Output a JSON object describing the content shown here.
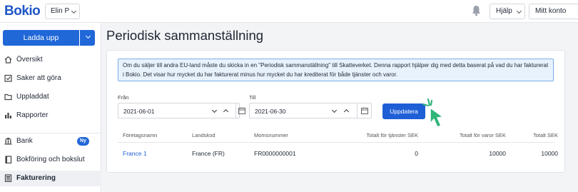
{
  "header": {
    "logo": "Bokio",
    "user": "Elin P",
    "help_label": "Hjälp",
    "account_label": "Mitt konto"
  },
  "sidebar": {
    "upload_label": "Ladda upp",
    "items": [
      {
        "label": "Översikt",
        "icon": "home-icon"
      },
      {
        "label": "Saker att göra",
        "icon": "checklist-icon"
      },
      {
        "label": "Uppladdat",
        "icon": "folder-icon"
      },
      {
        "label": "Rapporter",
        "icon": "bar-chart-icon"
      },
      {
        "label": "Bank",
        "icon": "bank-icon",
        "badge": "Ny"
      },
      {
        "label": "Bokföring och bokslut",
        "icon": "book-icon"
      },
      {
        "label": "Fakturering",
        "icon": "invoice-icon",
        "active": true
      }
    ]
  },
  "main": {
    "title": "Periodisk sammanställning",
    "info": "Om du säljer till andra EU-land måste du skicka in en \"Periodisk sammanställning\" till Skatteverket. Denna rapport hjälper dig med detta baserat på vad du har fakturerat i Bokio. Det visar hur mycket du har fakturerat minus hur mycket du har krediterat för både tjänster och varor.",
    "from_label": "Från",
    "from_value": "2021-06-01",
    "to_label": "Till",
    "to_value": "2021-06-30",
    "update_label": "Uppdatera",
    "table": {
      "headers": [
        "Företagsnamn",
        "Landskod",
        "Momsnummer",
        "Totalt för tjänster SEK",
        "Totalt för varor SEK",
        "Totalt SEK"
      ],
      "rows": [
        [
          "France 1",
          "France (FR)",
          "FR0000000001",
          "0",
          "10000",
          "10000"
        ]
      ]
    }
  },
  "colors": {
    "brand": "#1f57c7",
    "primary_button": "#2067d8",
    "info_bg": "#e8f2fc",
    "cursor": "#2fb47a"
  }
}
